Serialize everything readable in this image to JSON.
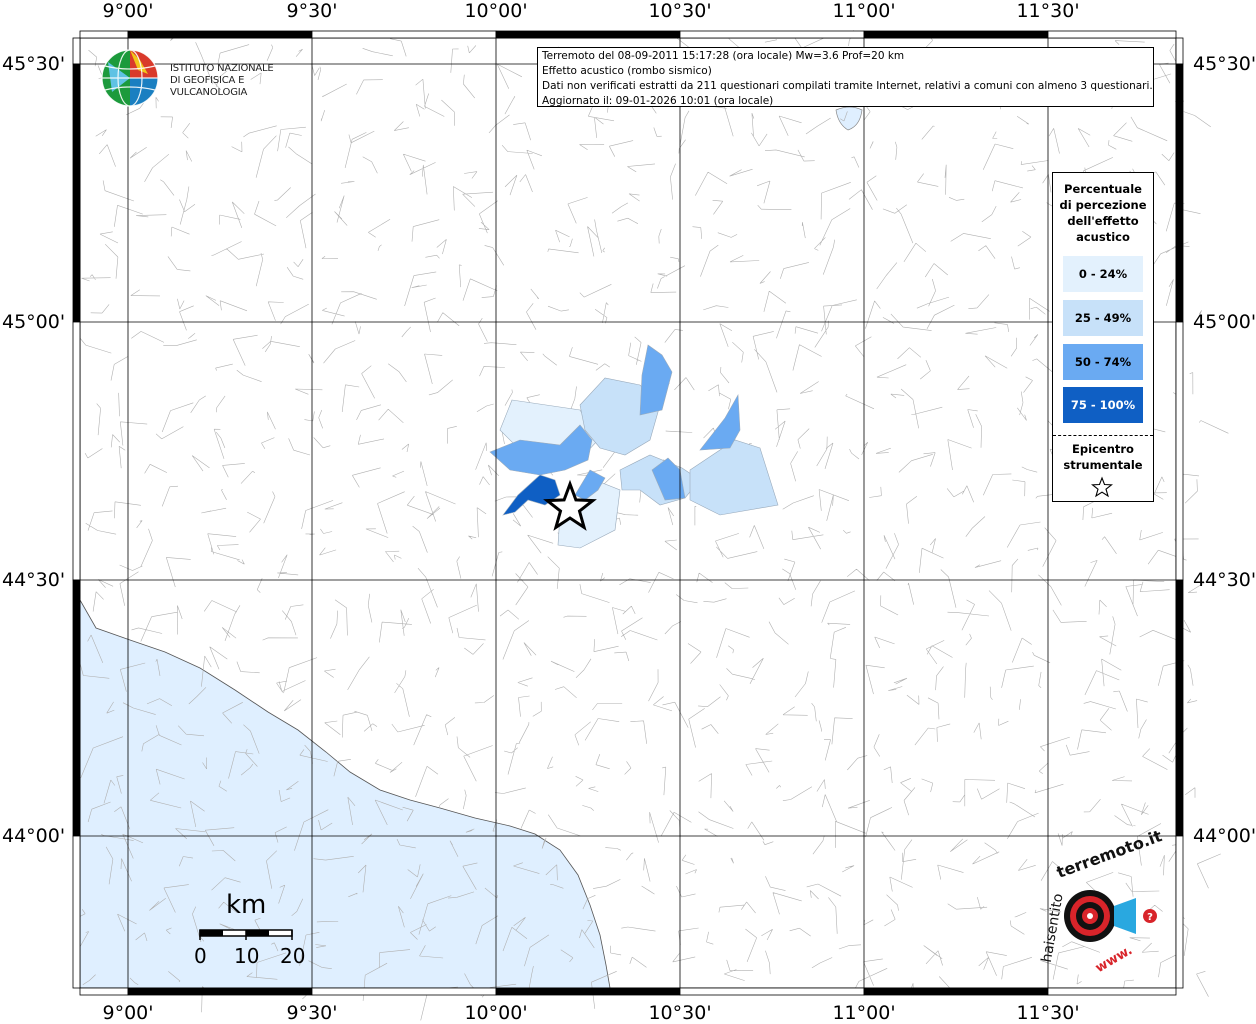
{
  "map": {
    "lon_ticks": [
      "9°00'",
      "9°30'",
      "10°00'",
      "10°30'",
      "11°00'",
      "11°30'"
    ],
    "lat_ticks": [
      "45°30'",
      "45°00'",
      "44°30'",
      "44°00'"
    ],
    "colors": {
      "sea": "#dfefff",
      "land": "#ffffff",
      "boundary": "#b0b0b0",
      "grid": "#000000"
    }
  },
  "info": {
    "line1": "Terremoto del 08-09-2011 15:17:28 (ora locale) Mw=3.6 Prof=20 km",
    "line2": "Effetto acustico (rombo sismico)",
    "line3": "Dati non verificati estratti da 211 questionari compilati tramite Internet, relativi a comuni con almeno 3 questionari.",
    "line4": "Aggiornato il: 09-01-2026 10:01 (ora locale)"
  },
  "ingv": {
    "line1": "ISTITUTO NAZIONALE",
    "line2": "DI GEOFISICA E VULCANOLOGIA"
  },
  "legend": {
    "title_lines": [
      "Percentuale",
      "di percezione",
      "dell'effetto",
      "acustico"
    ],
    "items": [
      {
        "label": "0 - 24%",
        "color": "#e3f1fd"
      },
      {
        "label": "25 - 49%",
        "color": "#c7e1f9"
      },
      {
        "label": "50 - 74%",
        "color": "#6aaaf2"
      },
      {
        "label": "75 - 100%",
        "color": "#0f5fc4"
      }
    ],
    "epicenter_lines": [
      "Epicentro",
      "strumentale"
    ]
  },
  "scale": {
    "unit": "km",
    "labels": [
      "0",
      "10",
      "20"
    ]
  },
  "haisentito": {
    "text_top": "terremoto.it",
    "text_left": "haisentito",
    "text_bottom": "www."
  }
}
